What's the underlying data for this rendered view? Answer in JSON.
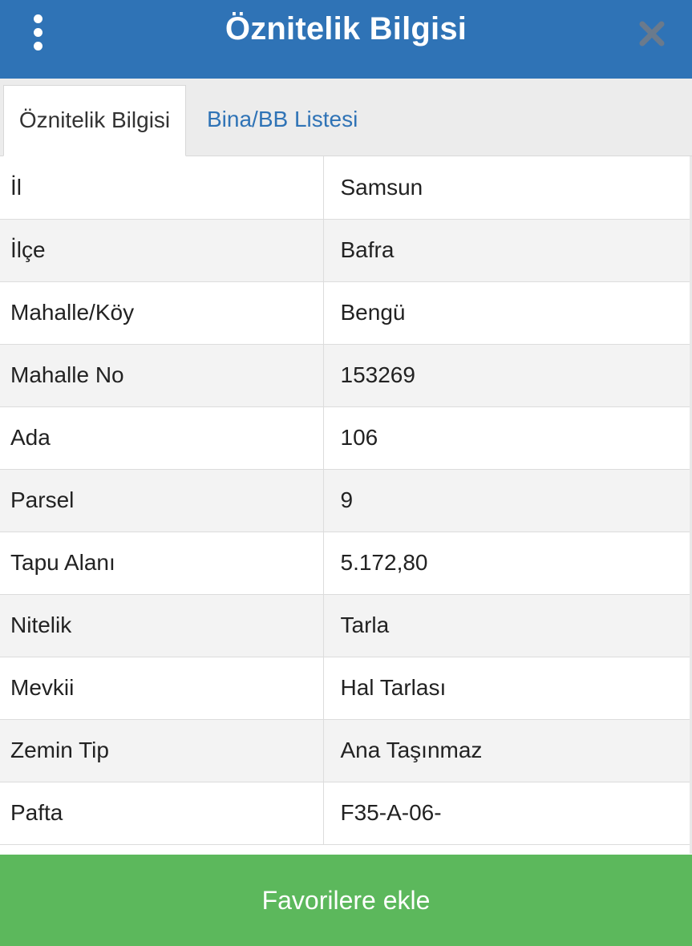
{
  "header": {
    "title": "Öznitelik Bilgisi",
    "menu_icon": "vertical-dots-icon",
    "close_icon": "close-icon"
  },
  "tabs": [
    {
      "label": "Öznitelik Bilgisi",
      "active": true
    },
    {
      "label": "Bina/BB Listesi",
      "active": false
    }
  ],
  "attributes": [
    {
      "key": "İl",
      "value": "Samsun"
    },
    {
      "key": "İlçe",
      "value": "Bafra"
    },
    {
      "key": "Mahalle/Köy",
      "value": "Bengü"
    },
    {
      "key": "Mahalle No",
      "value": "153269"
    },
    {
      "key": "Ada",
      "value": "106"
    },
    {
      "key": "Parsel",
      "value": "9"
    },
    {
      "key": "Tapu Alanı",
      "value": "5.172,80"
    },
    {
      "key": "Nitelik",
      "value": "Tarla"
    },
    {
      "key": "Mevkii",
      "value": "Hal Tarlası"
    },
    {
      "key": "Zemin Tip",
      "value": "Ana Taşınmaz"
    },
    {
      "key": "Pafta",
      "value": "F35-A-06-"
    }
  ],
  "footer": {
    "favorite_label": "Favorilere ekle"
  },
  "colors": {
    "header_bg": "#2f73b6",
    "tab_link": "#2f73b6",
    "button_bg": "#5cb85c"
  }
}
